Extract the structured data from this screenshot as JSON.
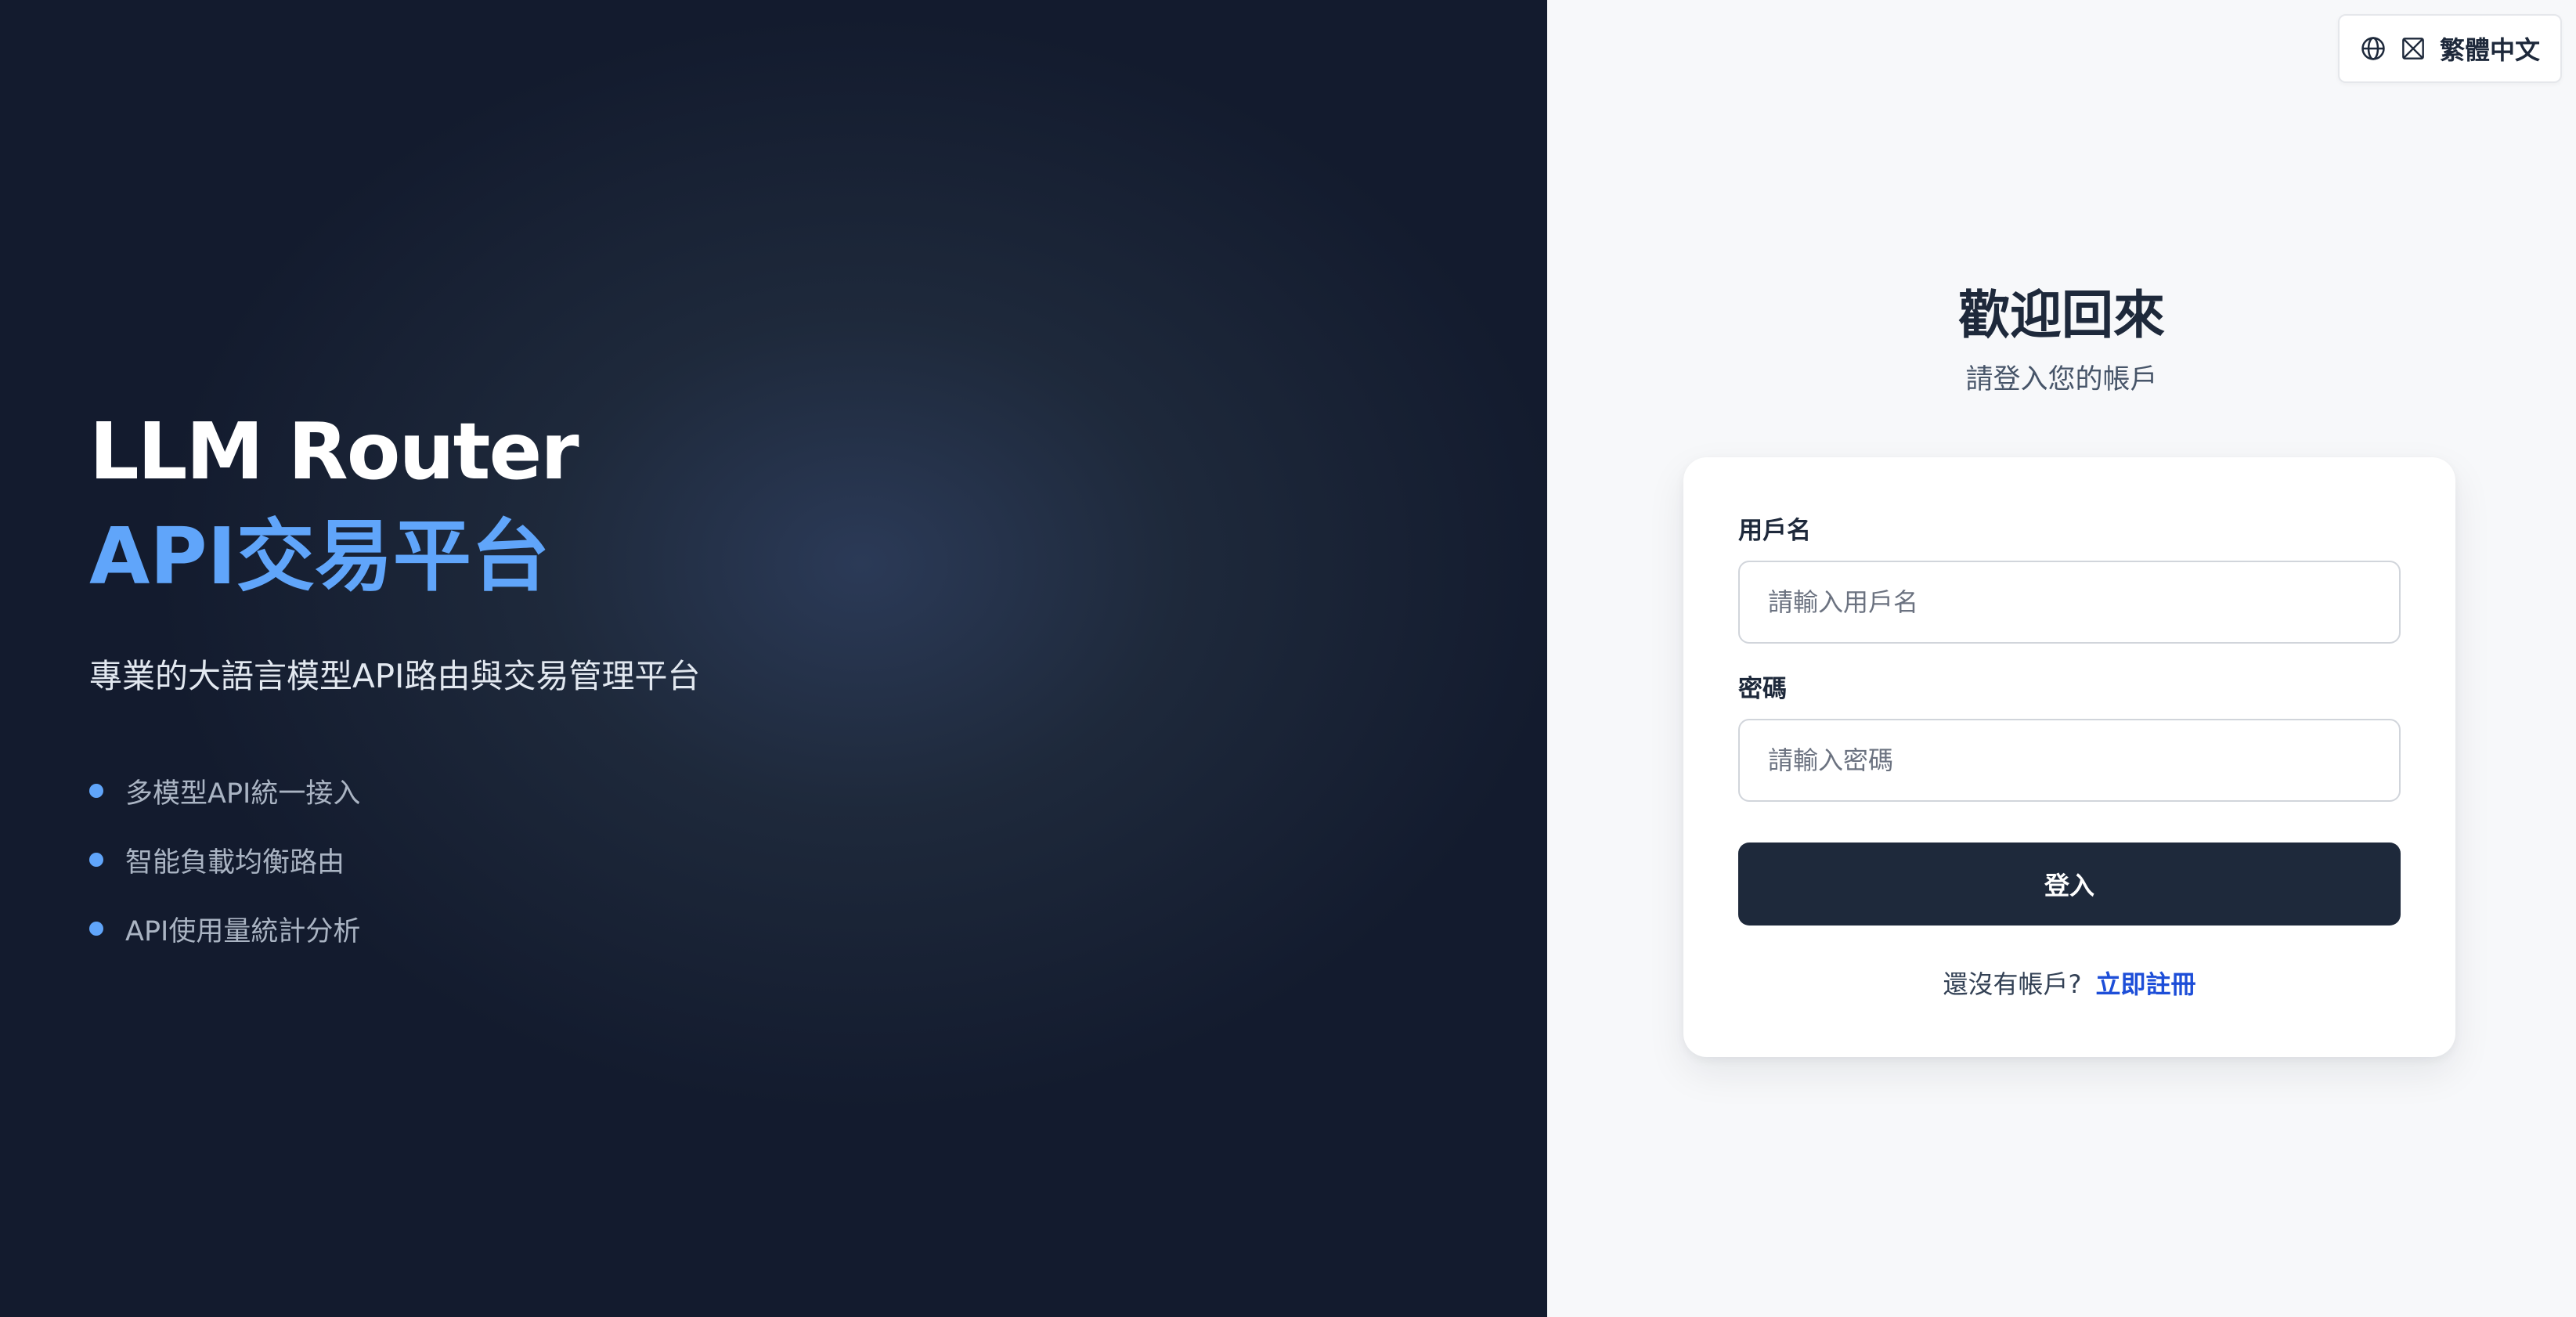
{
  "hero": {
    "title_line1": "LLM Router",
    "title_line2": "API交易平台",
    "description": "專業的大語言模型API路由與交易管理平台",
    "features": [
      "多模型API統一接入",
      "智能負載均衡路由",
      "API使用量統計分析"
    ]
  },
  "lang_switch": {
    "label": "繁體中文",
    "icons": [
      "globe-icon",
      "flag-icon"
    ]
  },
  "login": {
    "title": "歡迎回來",
    "subtitle": "請登入您的帳戶",
    "username_label": "用戶名",
    "username_placeholder": "請輸入用戶名",
    "username_value": "",
    "password_label": "密碼",
    "password_placeholder": "請輸入密碼",
    "password_value": "",
    "submit_label": "登入",
    "register_prompt": "還沒有帳戶?",
    "register_link": "立即註冊"
  },
  "colors": {
    "accent": "#60a5fa",
    "dark": "#1e293b",
    "link": "#1d4ed8"
  }
}
